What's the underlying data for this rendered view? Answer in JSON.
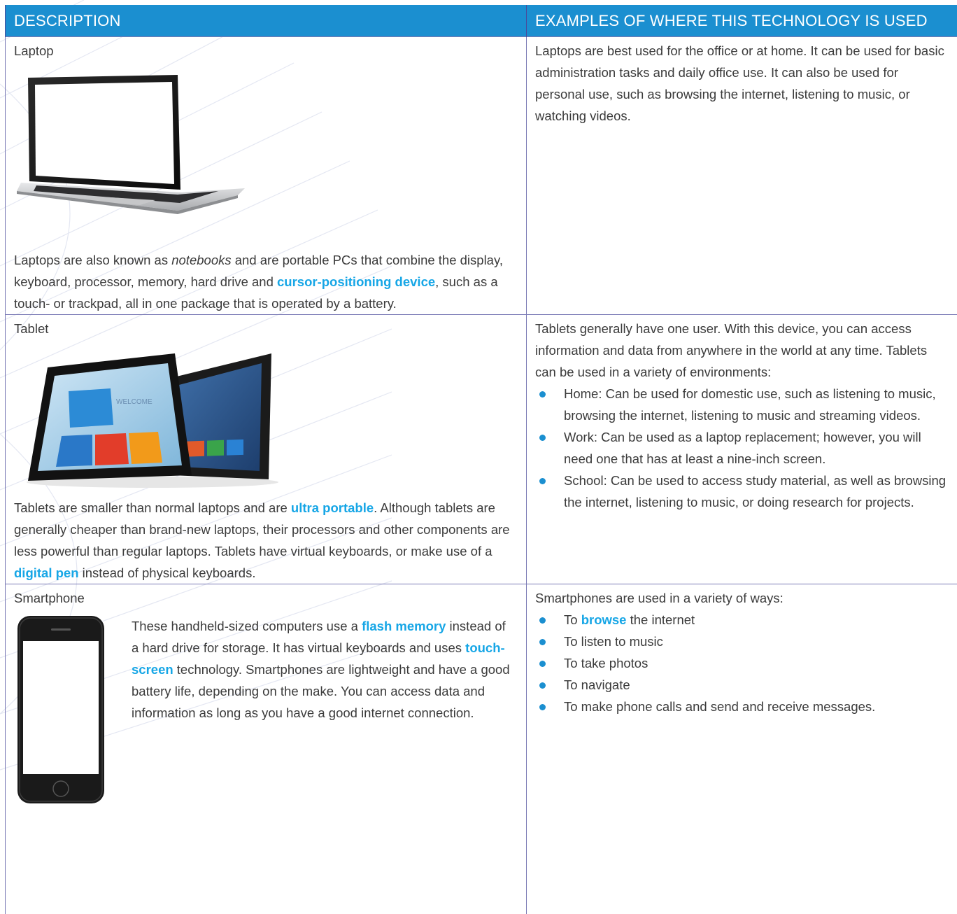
{
  "header": {
    "col1": "DESCRIPTION",
    "col2": "EXAMPLES OF WHERE THIS TECHNOLOGY IS USED"
  },
  "colors": {
    "header_bg": "#1b8fd0",
    "keyword": "#16a6e6",
    "border": "#7a7ab5",
    "text": "#3b3b3b"
  },
  "rows": [
    {
      "label": "Laptop",
      "image_icon": "laptop-image",
      "description": {
        "t1": "Laptops are also known as ",
        "em1": "notebooks",
        "t2": " and are portable PCs that combine the display, keyboard, processor, memory, hard drive and ",
        "kw1": "cursor-positioning device",
        "t3": ", such as a touch- or trackpad, all in one package that is operated by a battery."
      },
      "examples": {
        "text": "Laptops are best used for the office or at home. It can be used for basic administration tasks and daily office use. It can also be used for personal use, such as browsing the internet, listening to music, or watching videos."
      }
    },
    {
      "label": "Tablet",
      "image_icon": "tablet-image",
      "image_text": "WELCOME",
      "description": {
        "t1": "Tablets are smaller than normal laptops and are ",
        "kw1": "ultra portable",
        "t2": ". Although tablets are generally cheaper than brand-new laptops, their processors and other components are less powerful than regular laptops. Tablets have virtual keyboards, or make use of a ",
        "kw2": "digital pen",
        "t3": " instead of physical keyboards."
      },
      "examples": {
        "intro": "Tablets generally have one user. With this device, you can access information and data from anywhere in the world at any time. Tablets can be used in a variety of environments:",
        "bullets": [
          "Home: Can be used for domestic use, such as listening to music, browsing the internet, listening to music and streaming videos.",
          "Work: Can be used as a laptop replacement; however, you will need one that has at least a nine-inch screen.",
          "School: Can be used to access study material, as well as browsing the internet, listening to music, or doing research for projects."
        ]
      }
    },
    {
      "label": "Smartphone",
      "image_icon": "smartphone-image",
      "description": {
        "t1": "These handheld-sized computers use a ",
        "kw1": "flash memory",
        "t2": " instead of a hard drive for storage. It has virtual keyboards and uses ",
        "kw2": "touch-screen",
        "t3": " technology. Smartphones are lightweight and have a good battery life, depending on the make. You can access data and information as long as you have a good internet connection."
      },
      "examples": {
        "intro": "Smartphones are used in a variety of ways:",
        "b1_pre": "To ",
        "b1_kw": "browse",
        "b1_post": " the internet",
        "bullets": [
          "To listen to music",
          "To take photos",
          "To navigate",
          "To make phone calls and send and receive messages."
        ]
      }
    }
  ]
}
